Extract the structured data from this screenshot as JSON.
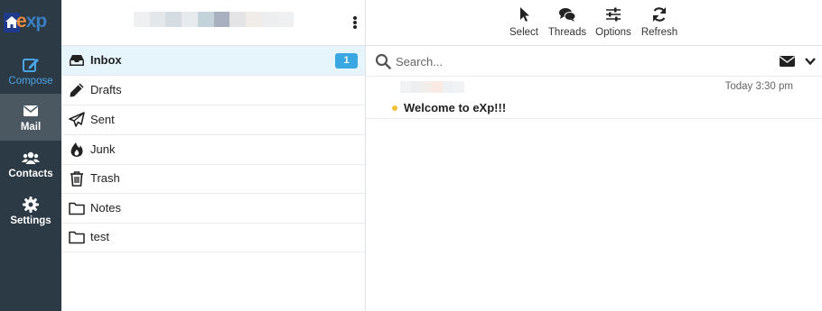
{
  "brand": {
    "logo_text_1": "e",
    "logo_text_2": "xp"
  },
  "nav": {
    "compose": "Compose",
    "mail": "Mail",
    "contacts": "Contacts",
    "settings": "Settings"
  },
  "folders": [
    {
      "name": "Inbox",
      "icon": "inbox-icon",
      "unread": "1"
    },
    {
      "name": "Drafts",
      "icon": "pencil-icon"
    },
    {
      "name": "Sent",
      "icon": "paper-plane-icon"
    },
    {
      "name": "Junk",
      "icon": "fire-icon"
    },
    {
      "name": "Trash",
      "icon": "trash-icon"
    },
    {
      "name": "Notes",
      "icon": "folder-icon"
    },
    {
      "name": "test",
      "icon": "folder-icon"
    }
  ],
  "toolbar": {
    "select": "Select",
    "threads": "Threads",
    "options": "Options",
    "refresh": "Refresh"
  },
  "search": {
    "placeholder": "Search..."
  },
  "messages": [
    {
      "date": "Today 3:30 pm",
      "subject": "Welcome to eXp!!!",
      "unread": true
    }
  ],
  "colors": {
    "rail": "#2c3a45",
    "accent": "#3aa6e2",
    "selected_folder_bg": "#e6f4fc",
    "unread_dot": "#f1c232"
  }
}
